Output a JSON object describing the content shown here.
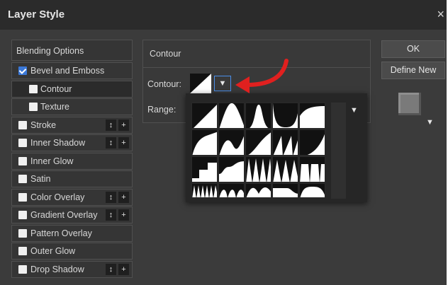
{
  "window": {
    "title": "Layer Style",
    "close_glyph": "×"
  },
  "styles_list": [
    {
      "label": "Blending Options",
      "kind": "header"
    },
    {
      "label": "Bevel and Emboss",
      "checked": true
    },
    {
      "label": "Contour",
      "checked": false,
      "sub": true,
      "selected": true
    },
    {
      "label": "Texture",
      "checked": false,
      "sub": true
    },
    {
      "label": "Stroke",
      "checked": false,
      "plus": true
    },
    {
      "label": "Inner Shadow",
      "checked": false,
      "plus": true
    },
    {
      "label": "Inner Glow",
      "checked": false
    },
    {
      "label": "Satin",
      "checked": false
    },
    {
      "label": "Color Overlay",
      "checked": false,
      "plus": true
    },
    {
      "label": "Gradient Overlay",
      "checked": false,
      "plus": true
    },
    {
      "label": "Pattern Overlay",
      "checked": false
    },
    {
      "label": "Outer Glow",
      "checked": false
    },
    {
      "label": "Drop Shadow",
      "checked": false,
      "plus": true
    }
  ],
  "mini_buttons": {
    "updown": "↕",
    "plus": "+"
  },
  "contour_panel": {
    "title": "Contour",
    "contour_label": "Contour:",
    "range_label": "Range:",
    "dropdown_glyph": "▼"
  },
  "buttons": {
    "ok": "OK",
    "define_new": "Define New"
  },
  "preview": {
    "dropdown_glyph": "▼"
  },
  "picker": {
    "dropdown_glyph": "▼"
  },
  "colors": {
    "accent": "#3a78d8",
    "highlight_arrow": "#e0201f",
    "dialog_bg": "#3b3b3b"
  }
}
